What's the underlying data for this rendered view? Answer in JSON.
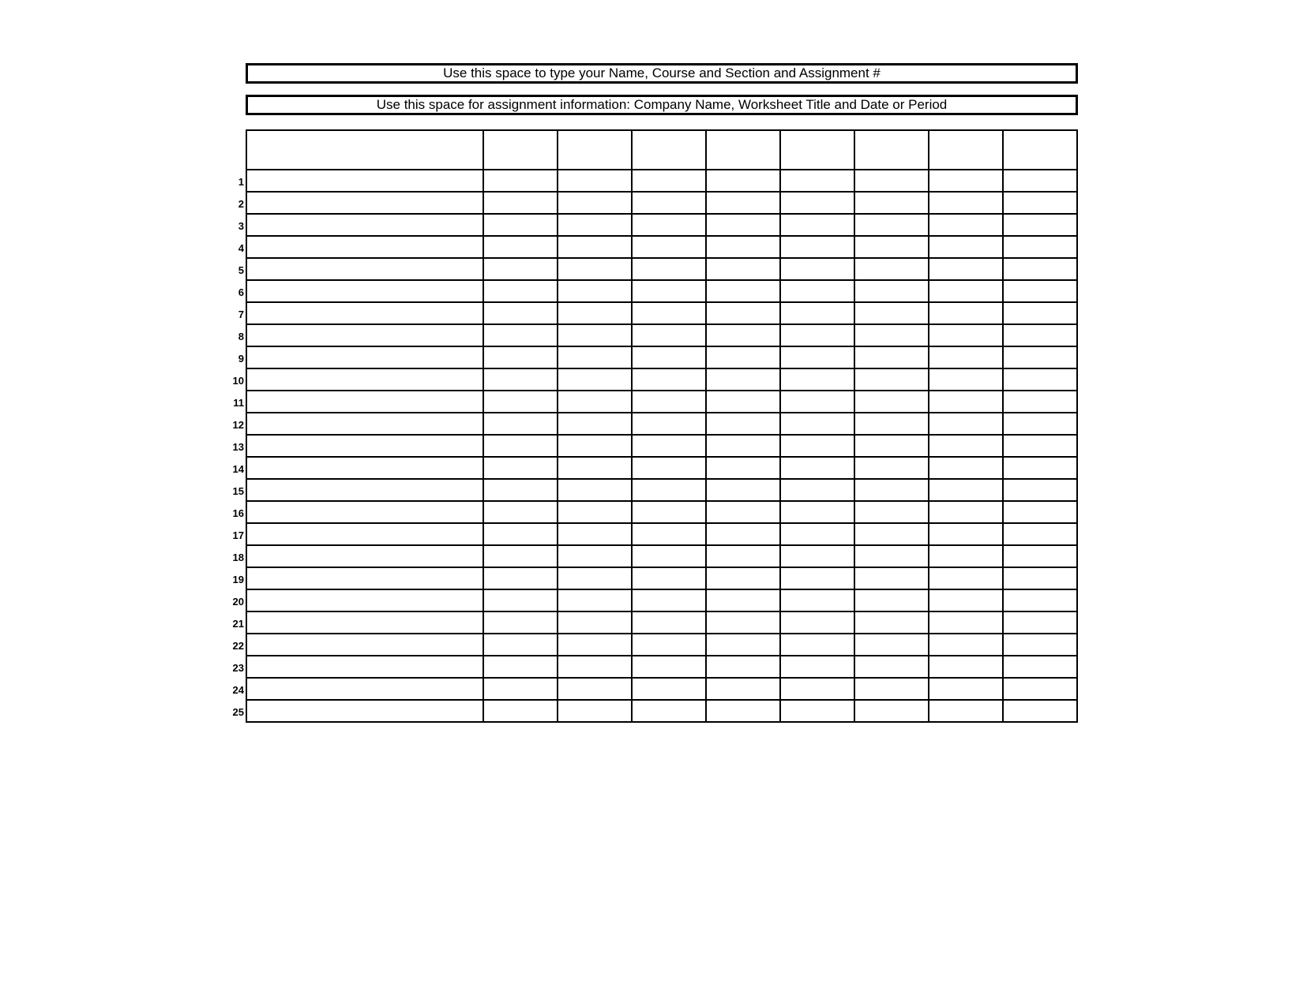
{
  "header1": "Use this space to type your Name, Course and Section and Assignment #",
  "header2": "Use this space for assignment information: Company Name, Worksheet Title and Date or Period",
  "rows": [
    "1",
    "2",
    "3",
    "4",
    "5",
    "6",
    "7",
    "8",
    "9",
    "10",
    "11",
    "12",
    "13",
    "14",
    "15",
    "16",
    "17",
    "18",
    "19",
    "20",
    "21",
    "22",
    "23",
    "24",
    "25"
  ]
}
